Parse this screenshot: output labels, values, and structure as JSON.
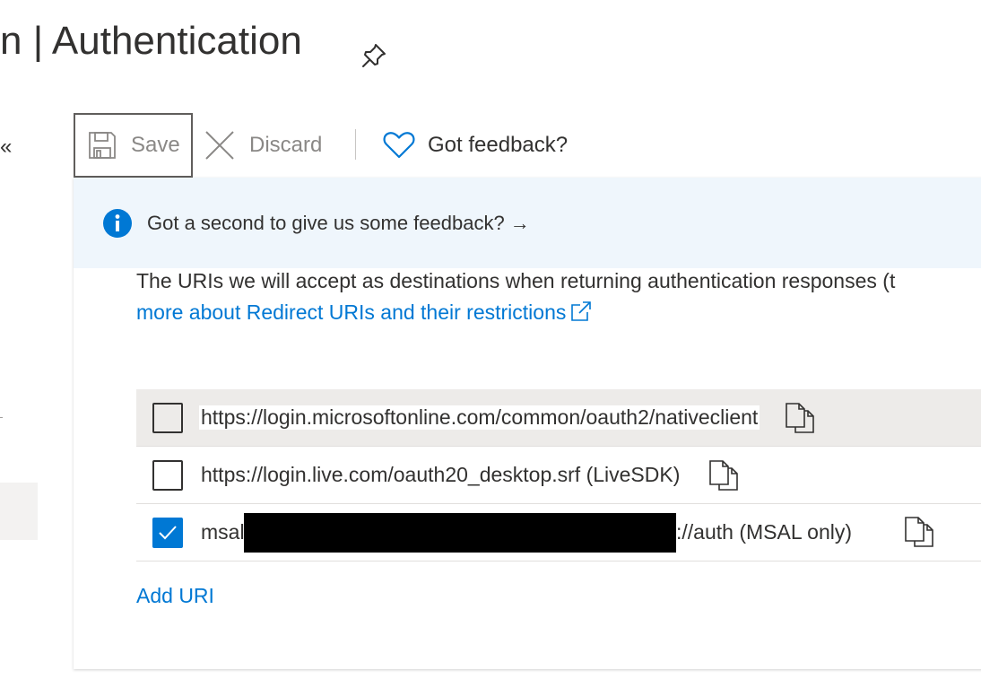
{
  "page": {
    "title": "n | Authentication",
    "pin_icon": "pin-icon"
  },
  "sidebar": {
    "collapse_glyph": "«"
  },
  "toolbar": {
    "save_label": "Save",
    "discard_label": "Discard",
    "feedback_label": "Got feedback?"
  },
  "banner": {
    "message": "Got a second to give us some feedback? →"
  },
  "redirect": {
    "description": "The URIs we will accept as destinations when returning authentication responses (t",
    "learn_more_link": "more about Redirect URIs and their restrictions",
    "uris": [
      {
        "url": "https://login.microsoftonline.com/common/oauth2/nativeclient",
        "checked": false
      },
      {
        "url": "https://login.live.com/oauth20_desktop.srf (LiveSDK)",
        "checked": false
      },
      {
        "url_prefix": "msal",
        "url_suffix": "://auth (MSAL only)",
        "checked": true
      }
    ],
    "add_uri_label": "Add URI"
  },
  "colors": {
    "accent": "#0078d4",
    "banner_bg": "#eff6fc",
    "text": "#323130",
    "disabled_text": "#8a8886"
  }
}
